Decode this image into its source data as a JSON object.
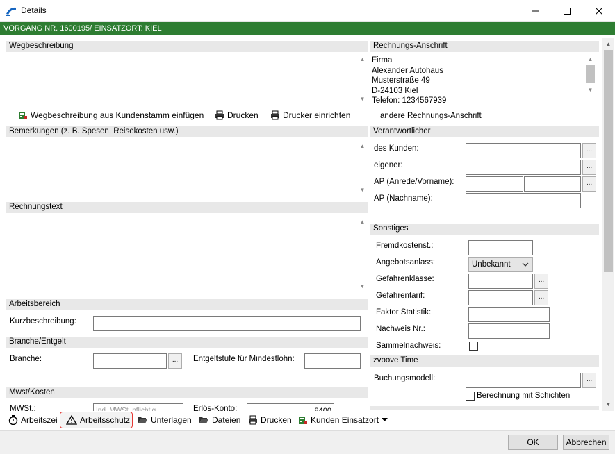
{
  "window": {
    "title": "Details",
    "minimize": "—",
    "maximize": "☐",
    "close": "✕"
  },
  "header": {
    "text": "VORGANG NR. 1600195/ EINSATZORT: KIEL"
  },
  "left": {
    "wegbeschreibung": {
      "heading": "Wegbeschreibung",
      "text": ""
    },
    "weg_toolbar": {
      "einfuegen": "Wegbeschreibung aus Kundenstamm einfügen",
      "drucken": "Drucken",
      "drucker": "Drucker einrichten"
    },
    "bemerkungen": {
      "heading": "Bemerkungen (z. B. Spesen, Reisekosten usw.)"
    },
    "rechnungstext": {
      "heading": "Rechnungstext"
    },
    "arbeitsbereich": {
      "heading": "Arbeitsbereich",
      "kurz_label": "Kurzbeschreibung:",
      "kurz_value": ""
    },
    "branche": {
      "heading": "Branche/Entgelt",
      "branche_label": "Branche:",
      "entgelt_label": "Entgeltstufe für Mindestlohn:"
    },
    "mwst": {
      "heading": "Mwst/Kosten",
      "mwst_label": "MWSt.:",
      "mwst_value": "Ind. MWSt. pflichtig",
      "erloes_label": "Erlös-Konto:",
      "erloes_value": "8400"
    }
  },
  "right": {
    "rechnung": {
      "heading": "Rechnungs-Anschrift",
      "lines": [
        "Firma",
        "Alexander Autohaus",
        "Musterstraße 49",
        "D-24103 Kiel",
        "Telefon: 1234567939"
      ],
      "andere": "andere Rechnungs-Anschrift"
    },
    "verantwortlicher": {
      "heading": "Verantwortlicher",
      "kunden": "des Kunden:",
      "eigener": "eigener:",
      "ap_anrede": "AP (Anrede/Vorname):",
      "ap_nachname": "AP (Nachname):"
    },
    "sonstiges": {
      "heading": "Sonstiges",
      "fremdkostenst": "Fremdkostenst.:",
      "angebotsanlass": "Angebotsanlass:",
      "angebotsanlass_value": "Unbekannt",
      "gefahrenklasse": "Gefahrenklasse:",
      "gefahrentarif": "Gefahrentarif:",
      "faktor": "Faktor Statistik:",
      "nachweis": "Nachweis Nr.:",
      "sammelnachweis": "Sammelnachweis:"
    },
    "zvoove": {
      "heading": "zvoove Time",
      "buchungsmodell": "Buchungsmodell:",
      "berechnung": "Berechnung mit Schichten"
    }
  },
  "bottom_toolbar": {
    "arbeitszeit": "Arbeitszei",
    "arbeitsschutz": "Arbeitsschutz",
    "unterlagen": "Unterlagen",
    "dateien": "Dateien",
    "drucken": "Drucken",
    "kunden": "Kunden Einsatzort"
  },
  "footer": {
    "ok": "OK",
    "abbrechen": "Abbrechen"
  },
  "colors": {
    "green": "#2e7d32",
    "highlight": "#e53935"
  },
  "icons": {
    "dots": "..."
  }
}
